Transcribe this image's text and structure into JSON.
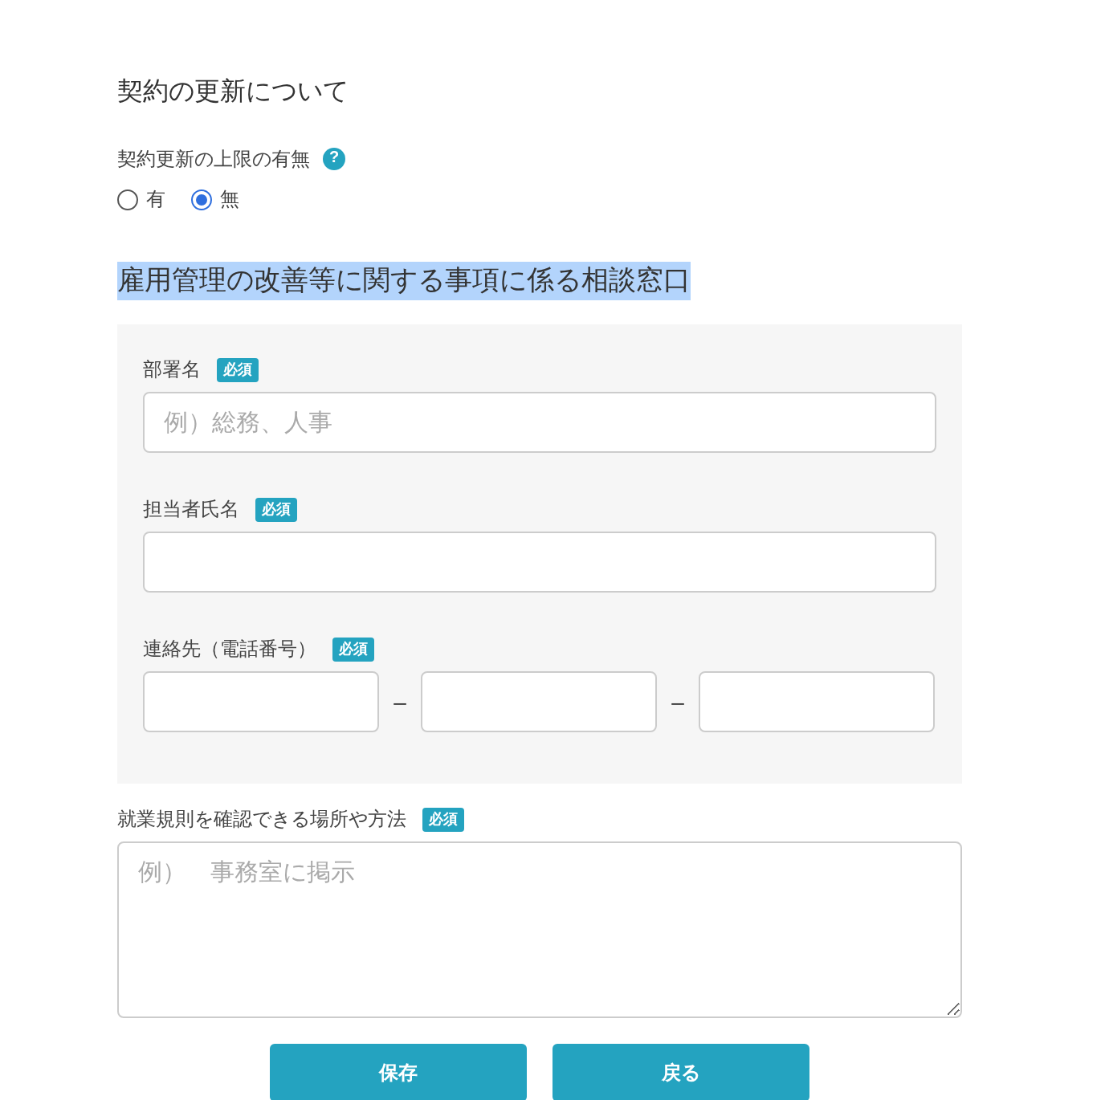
{
  "section_title": "契約の更新について",
  "renewal_limit": {
    "label": "契約更新の上限の有無",
    "help": "?",
    "options": [
      {
        "label": "有",
        "selected": false
      },
      {
        "label": "無",
        "selected": true
      }
    ]
  },
  "contact_heading": {
    "text": "雇用管理の改善等に関する事項に係る相談窓口",
    "highlighted": true
  },
  "contact_fields": [
    {
      "kind": "text",
      "label": "部署名",
      "badge": "必須",
      "placeholder": "例）総務、人事"
    },
    {
      "kind": "text",
      "label": "担当者氏名",
      "badge": "必須"
    },
    {
      "kind": "phone",
      "label": "連絡先（電話番号）",
      "badge": "必須",
      "separators": [
        "–",
        "–"
      ]
    }
  ],
  "rules_field": {
    "label": "就業規則を確認できる場所や方法",
    "badge": "必須",
    "placeholder": "例）　事務室に掲示"
  },
  "buttons": [
    "保存",
    "戻る"
  ]
}
